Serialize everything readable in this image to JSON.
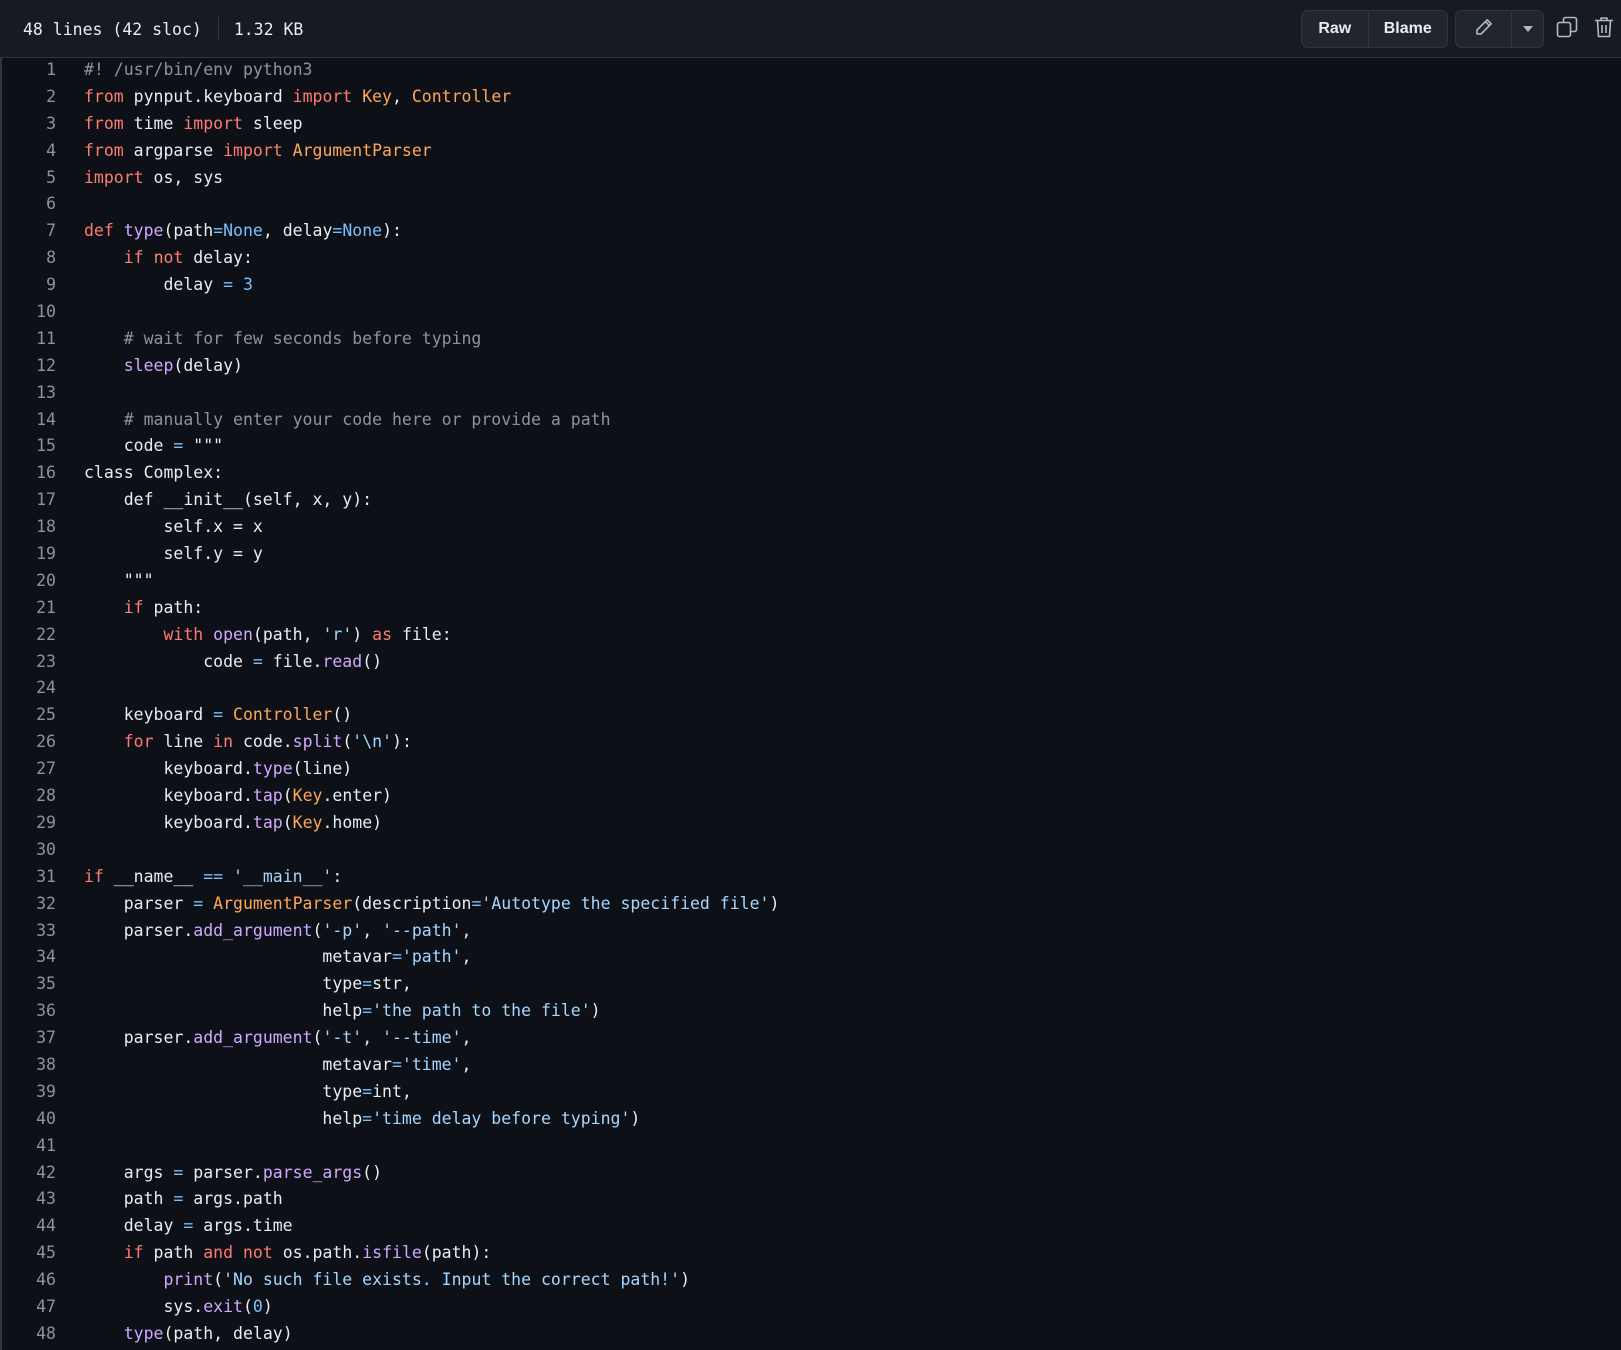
{
  "file_info": {
    "lines_text": "48 lines (42 sloc)",
    "size_text": "1.32 KB"
  },
  "toolbar": {
    "raw_label": "Raw",
    "blame_label": "Blame",
    "edit_icon": "pencil-icon",
    "dropdown_icon": "triangle-down-icon",
    "copy_icon": "copy-icon",
    "delete_icon": "trash-icon"
  },
  "colors": {
    "background": "#0d1117",
    "keyword": "#ff7b72",
    "comment": "#8b949e",
    "string": "#a5d6ff",
    "constant": "#79c0ff",
    "function": "#d2a8ff",
    "class": "#ffa657"
  },
  "code": {
    "language": "python",
    "lines": [
      "#! /usr/bin/env python3",
      "from pynput.keyboard import Key, Controller",
      "from time import sleep",
      "from argparse import ArgumentParser",
      "import os, sys",
      "",
      "def type(path=None, delay=None):",
      "    if not delay:",
      "        delay = 3",
      "",
      "    # wait for few seconds before typing",
      "    sleep(delay)",
      "",
      "    # manually enter your code here or provide a path",
      "    code = \"\"\"",
      "class Complex:",
      "    def __init__(self, x, y):",
      "        self.x = x",
      "        self.y = y",
      "    \"\"\"",
      "    if path:",
      "        with open(path, 'r') as file:",
      "            code = file.read()",
      "",
      "    keyboard = Controller()",
      "    for line in code.split('\\n'):",
      "        keyboard.type(line)",
      "        keyboard.tap(Key.enter)",
      "        keyboard.tap(Key.home)",
      "",
      "if __name__ == '__main__':",
      "    parser = ArgumentParser(description='Autotype the specified file')",
      "    parser.add_argument('-p', '--path',",
      "                        metavar='path',",
      "                        type=str,",
      "                        help='the path to the file')",
      "    parser.add_argument('-t', '--time',",
      "                        metavar='time',",
      "                        type=int,",
      "                        help='time delay before typing')",
      "",
      "    args = parser.parse_args()",
      "    path = args.path",
      "    delay = args.time",
      "    if path and not os.path.isfile(path):",
      "        print('No such file exists. Input the correct path!')",
      "        sys.exit(0)",
      "    type(path, delay)"
    ]
  }
}
